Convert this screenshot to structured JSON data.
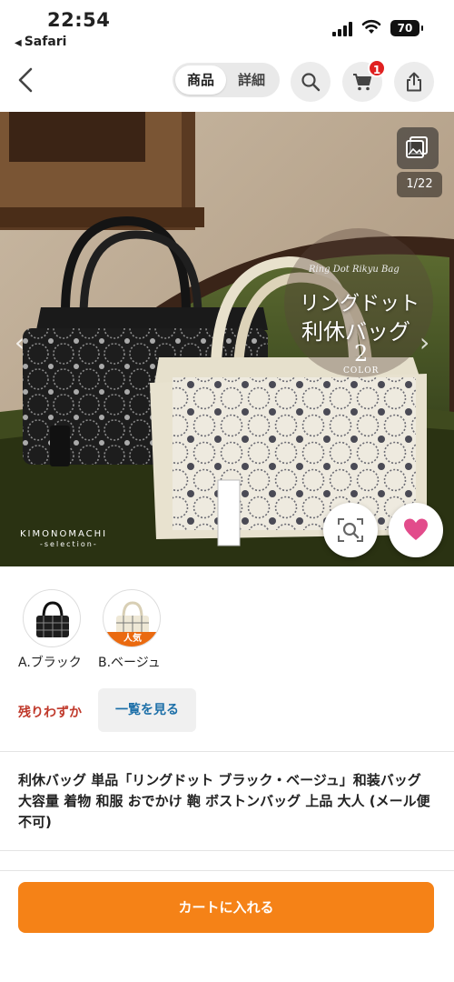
{
  "status_bar": {
    "time": "22:54",
    "back_app": "Safari",
    "battery": "70"
  },
  "nav": {
    "tabs": [
      {
        "label": "商品",
        "active": true
      },
      {
        "label": "詳細",
        "active": false
      }
    ],
    "cart_count": "1",
    "icons": [
      "back-chevron-icon",
      "search-icon",
      "cart-icon",
      "share-icon"
    ]
  },
  "hero": {
    "image_counter": "1/22",
    "overlay": {
      "script": "Ring Dot Rikyu Bag",
      "title": "リングドット",
      "subtitle": "利休バッグ",
      "number": "2",
      "color": "COLOR"
    },
    "watermark": "KIMONOMACHI",
    "watermark_sub": "-selection-"
  },
  "variants": [
    {
      "label": "A.ブラック",
      "badge": ""
    },
    {
      "label": "B.ベージュ",
      "badge": "人気"
    }
  ],
  "stock": {
    "status": "残りわずか",
    "list_button": "一覧を見る"
  },
  "product_title": "利休バッグ 単品「リングドット ブラック・ベージュ」和装バッグ 大容量 着物 和服 おでかけ 鞄 ボストンバッグ 上品 大人 (メール便不可)",
  "cart_button": "カートに入れる",
  "colors": {
    "accent": "#f58217",
    "badge": "#e02020",
    "stock": "#c0392b",
    "link": "#1c6fa8",
    "favorite": "#e24c8b"
  }
}
